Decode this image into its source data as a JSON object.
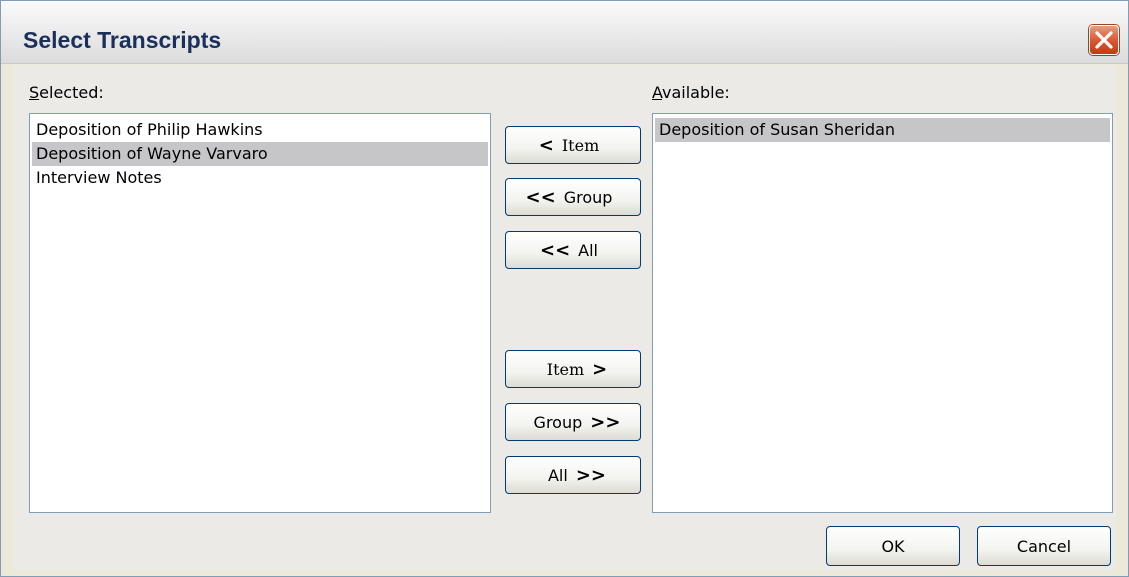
{
  "dialog": {
    "title": "Select Transcripts"
  },
  "selected": {
    "label_mnemonic": "S",
    "label_rest": "elected:",
    "items": [
      {
        "label": "Deposition of Philip Hawkins",
        "selected": false
      },
      {
        "label": "Deposition of Wayne Varvaro",
        "selected": true
      },
      {
        "label": "Interview Notes",
        "selected": false
      }
    ]
  },
  "available": {
    "label_mnemonic": "A",
    "label_rest": "vailable:",
    "items": [
      {
        "label": "Deposition of Susan Sheridan",
        "selected": true
      }
    ]
  },
  "move_buttons": {
    "item_left": "Item",
    "group_left": "Group",
    "all_left": "All",
    "item_right": "Item",
    "group_right": "Group",
    "all_right": "All",
    "single_left_glyph": "<",
    "double_left_glyph": "<<",
    "single_right_glyph": ">",
    "double_right_glyph": ">>"
  },
  "footer": {
    "ok": "OK",
    "cancel": "Cancel"
  },
  "colors": {
    "selection": "#c6c6c8",
    "border": "#7f9db9",
    "close_button": "#d8562f"
  },
  "icons": {
    "close": "close-icon"
  }
}
